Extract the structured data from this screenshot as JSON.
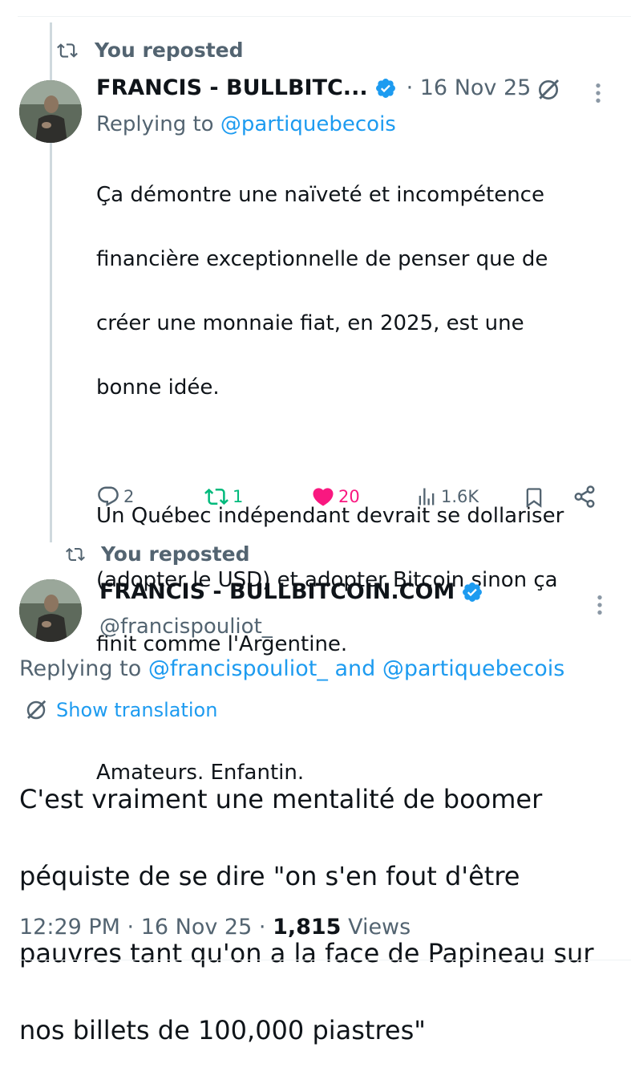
{
  "repost1": {
    "label": "You reposted"
  },
  "tweet1": {
    "display_name": "FRANCIS - BULLBITC...",
    "date": "· 16 Nov 25",
    "replying_prefix": "Replying to",
    "replying_handle": "@partiquebecois",
    "text": "Ça démontre une naïveté et incompétence financière exceptionnelle de penser que de créer une monnaie fiat, en 2025, est une bonne idée.",
    "text_line1": "Ça démontre une naïveté et incompétence",
    "text_line2": "financière exceptionnelle de penser que de",
    "text_line3": "créer une monnaie fiat, en 2025, est une",
    "text_line4": "bonne idée.",
    "text_p2_line1": "Un Québec indépendant devrait se dollariser",
    "text_p2_line2": "(adopter le USD) et adopter Bitcoin sinon ça",
    "text_p2_line3": "finit comme l'Argentine.",
    "text_p3": "Amateurs. Enfantin.",
    "replies": "2",
    "reposts": "1",
    "likes": "20",
    "views": "1.6K"
  },
  "repost2": {
    "label": "You reposted"
  },
  "tweet2": {
    "display_name": "FRANCIS - BULLBITCOIN.COM",
    "handle": "@francispouliot_",
    "replying_prefix": "Replying to",
    "replying_handle1": "@francispouliot_",
    "replying_and": "and",
    "replying_handle2": "@partiquebecois",
    "show_translation": "Show translation",
    "text_line1": "C'est vraiment une mentalité de boomer",
    "text_line2": "péquiste de se dire \"on s'en fout d'être",
    "text_line3": "pauvres tant qu'on a la face de Papineau sur",
    "text_line4": "nos billets de 100,000 piastres\"",
    "time": "12:29 PM · 16 Nov 25 ·",
    "view_count": "1,815",
    "views_label": "Views"
  },
  "colors": {
    "accent": "#1d9bf0",
    "repost_green": "#00ba7c",
    "like_pink": "#f91880",
    "secondary_text": "#536471",
    "thread_line": "#cfd9de"
  },
  "icons": [
    "repost-icon",
    "verified-badge-icon",
    "grok-translate-icon",
    "more-icon",
    "reply-icon",
    "like-icon",
    "views-icon",
    "bookmark-icon",
    "share-icon"
  ]
}
